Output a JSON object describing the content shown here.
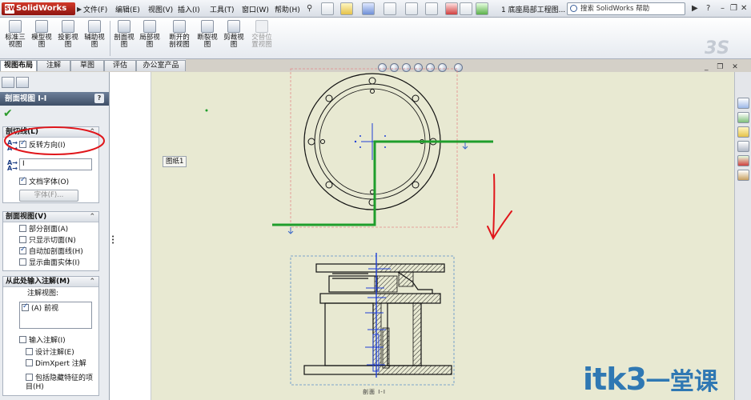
{
  "app": {
    "name": "SolidWorks",
    "document_title": "1 底座局部工程图..."
  },
  "menu": [
    "文件(F)",
    "编辑(E)",
    "视图(V)",
    "插入(I)",
    "工具(T)",
    "窗口(W)",
    "帮助(H)"
  ],
  "help_search": {
    "placeholder": "搜索 SolidWorks 帮助"
  },
  "commands": [
    {
      "label": "标准三\n视图",
      "enabled": true
    },
    {
      "label": "模型视\n图",
      "enabled": true
    },
    {
      "label": "投影视\n图",
      "enabled": true
    },
    {
      "label": "辅助视\n图",
      "enabled": true
    },
    {
      "label": "剖面视\n图",
      "enabled": true
    },
    {
      "label": "局部视\n图",
      "enabled": true
    },
    {
      "label": "断开的\n剖视图",
      "enabled": true
    },
    {
      "label": "断裂视\n图",
      "enabled": true
    },
    {
      "label": "剪裁视\n图",
      "enabled": true
    },
    {
      "label": "交替位\n置视图",
      "enabled": false
    }
  ],
  "tabs": [
    "视图布局",
    "注解",
    "草图",
    "评估",
    "办公室产品"
  ],
  "property_manager": {
    "title": "剖面视图 I-I",
    "help": "?",
    "cutting_line": {
      "header": "剖切线(L)",
      "flip_direction": "反转方向(I)",
      "label_value": "I",
      "doc_font": "文档字体(O)",
      "font_button": "字体(F)..."
    },
    "section_view": {
      "header": "剖面视图(V)",
      "options": [
        {
          "label": "部分剖面(A)",
          "checked": false
        },
        {
          "label": "只显示切面(N)",
          "checked": false
        },
        {
          "label": "自动加剖面线(H)",
          "checked": true
        },
        {
          "label": "显示曲面实体(I)",
          "checked": false
        }
      ]
    },
    "import_annotations": {
      "header": "从此处输入注解(M)",
      "annotation_view_label": "注解视图:",
      "annotation_view_item": "(A) 前视",
      "import": "输入注解(I)",
      "design": "设计注解(E)",
      "dimxpert": "DimXpert 注解",
      "hidden": "包括隐藏特征的项目(H)"
    }
  },
  "canvas": {
    "sheet_tag": "图纸1",
    "section_label": "剖面 I-I"
  },
  "watermark": {
    "brand": "itk3",
    "sub": "一堂课"
  },
  "colors": {
    "cutting_line": "#1f9e2c",
    "highlight_circle": "#e0161b",
    "red_arrow": "#e0161b",
    "dim_blue": "#1f3fd6",
    "background": "#e8e9d2",
    "brand_blue": "#2f78b3"
  }
}
